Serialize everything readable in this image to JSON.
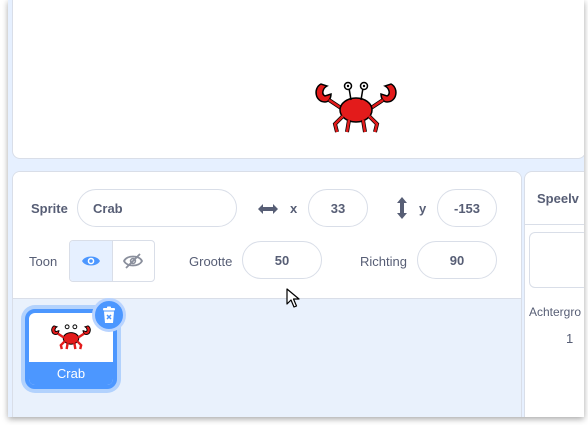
{
  "sprite_info": {
    "sprite_label": "Sprite",
    "sprite_name": "Crab",
    "x_label": "x",
    "x_value": "33",
    "y_label": "y",
    "y_value": "-153",
    "show_label": "Toon",
    "size_label": "Grootte",
    "size_value": "50",
    "direction_label": "Richting",
    "direction_value": "90"
  },
  "sprite_list": {
    "items": [
      {
        "label": "Crab"
      }
    ]
  },
  "stage_panel": {
    "tab_label": "Speelv",
    "backdrops_label": "Achtergro",
    "backdrops_count": "1"
  },
  "icons": [
    "crab-sprite",
    "horizontal-arrows-icon",
    "vertical-arrows-icon",
    "eye-icon",
    "eye-slash-icon",
    "trash-icon",
    "mouse-cursor-icon"
  ],
  "colors": {
    "accent": "#4c97ff",
    "text": "#575e75",
    "pane": "#e9f1fc"
  }
}
